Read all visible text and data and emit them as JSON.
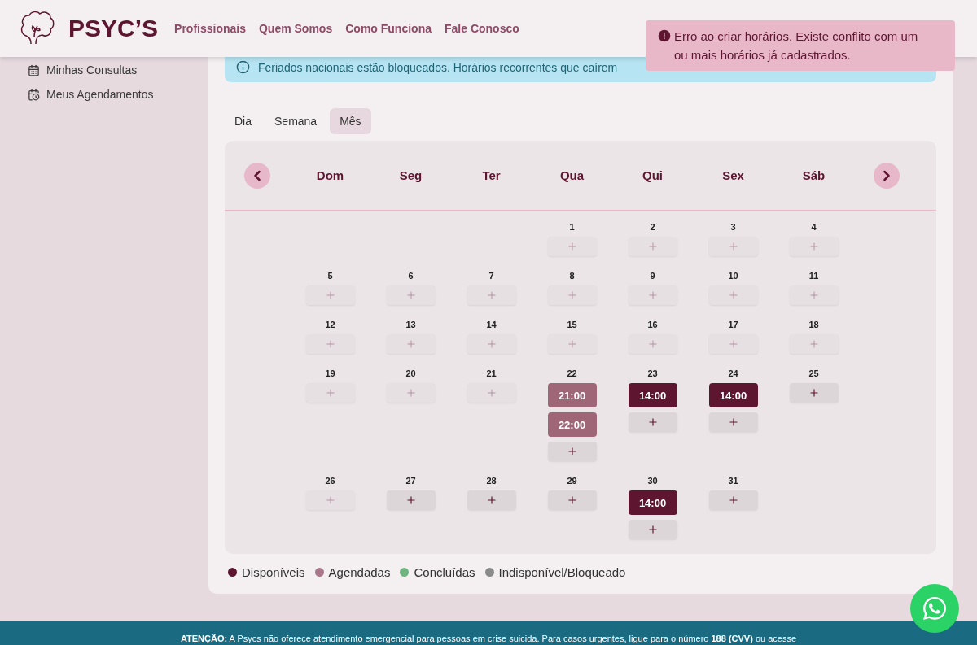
{
  "header": {
    "logo": "PSYC’S",
    "nav": [
      "Profissionais",
      "Quem Somos",
      "Como Funciona",
      "Fale Conosco"
    ]
  },
  "toast": {
    "message": "Erro ao criar horários. Existe conflito com um ou mais horários já cadastrados."
  },
  "sidebar": {
    "items": [
      {
        "label": "Minhas Consultas"
      },
      {
        "label": "Meus Agendamentos"
      }
    ]
  },
  "banner": {
    "text": "Feriados nacionais estão bloqueados. Horários recorrentes que caírem"
  },
  "view_tabs": [
    {
      "label": "Dia",
      "selected": false
    },
    {
      "label": "Semana",
      "selected": false
    },
    {
      "label": "Mês",
      "selected": true
    }
  ],
  "calendar": {
    "weekdays": [
      "Dom",
      "Seg",
      "Ter",
      "Qua",
      "Qui",
      "Sex",
      "Sáb"
    ],
    "weeks": [
      [
        {
          "kind": "blank"
        },
        {
          "kind": "blank"
        },
        {
          "kind": "blank"
        },
        {
          "kind": "day",
          "day": "1",
          "disabled": true
        },
        {
          "kind": "day",
          "day": "2",
          "disabled": true
        },
        {
          "kind": "day",
          "day": "3",
          "disabled": true
        },
        {
          "kind": "day",
          "day": "4",
          "disabled": true
        }
      ],
      [
        {
          "kind": "day",
          "day": "5",
          "disabled": true
        },
        {
          "kind": "day",
          "day": "6",
          "disabled": true
        },
        {
          "kind": "day",
          "day": "7",
          "disabled": true
        },
        {
          "kind": "day",
          "day": "8",
          "disabled": true
        },
        {
          "kind": "day",
          "day": "9",
          "disabled": true
        },
        {
          "kind": "day",
          "day": "10",
          "disabled": true
        },
        {
          "kind": "day",
          "day": "11",
          "disabled": true
        }
      ],
      [
        {
          "kind": "day",
          "day": "12",
          "disabled": true
        },
        {
          "kind": "day",
          "day": "13",
          "disabled": true
        },
        {
          "kind": "day",
          "day": "14",
          "disabled": true
        },
        {
          "kind": "day",
          "day": "15",
          "disabled": true
        },
        {
          "kind": "day",
          "day": "16",
          "disabled": true
        },
        {
          "kind": "day",
          "day": "17",
          "disabled": true
        },
        {
          "kind": "day",
          "day": "18",
          "disabled": true
        }
      ],
      [
        {
          "kind": "day",
          "day": "19",
          "disabled": true
        },
        {
          "kind": "day",
          "day": "20",
          "disabled": true
        },
        {
          "kind": "day",
          "day": "21",
          "disabled": true
        },
        {
          "kind": "day",
          "day": "22",
          "disabled": false,
          "slots": [
            {
              "time": "21:00",
              "kind": "scheduled"
            },
            {
              "time": "22:00",
              "kind": "scheduled"
            }
          ]
        },
        {
          "kind": "day",
          "day": "23",
          "disabled": false,
          "slots": [
            {
              "time": "14:00",
              "kind": "available"
            }
          ]
        },
        {
          "kind": "day",
          "day": "24",
          "disabled": false,
          "slots": [
            {
              "time": "14:00",
              "kind": "available"
            }
          ]
        },
        {
          "kind": "day",
          "day": "25",
          "disabled": false
        }
      ],
      [
        {
          "kind": "day",
          "day": "26",
          "disabled": true
        },
        {
          "kind": "day",
          "day": "27",
          "disabled": false
        },
        {
          "kind": "day",
          "day": "28",
          "disabled": false
        },
        {
          "kind": "day",
          "day": "29",
          "disabled": false
        },
        {
          "kind": "day",
          "day": "30",
          "disabled": false,
          "slots": [
            {
              "time": "14:00",
              "kind": "available"
            }
          ]
        },
        {
          "kind": "day",
          "day": "31",
          "disabled": false
        },
        {
          "kind": "blank"
        }
      ]
    ]
  },
  "legend": [
    {
      "label": "Disponíveis",
      "color": "#5e1530"
    },
    {
      "label": "Agendadas",
      "color": "#a8788a"
    },
    {
      "label": "Concluídas",
      "color": "#6fb47f"
    },
    {
      "label": "Indisponível/Bloqueado",
      "color": "#8a8a8a"
    }
  ],
  "footer": {
    "text": "**ATENÇÃO:** A Psycs não oferece atendimento emergencial para pessoas em crise suicida. Para casos urgentes, ligue para o número **188 (CVV)** ou acesse"
  }
}
